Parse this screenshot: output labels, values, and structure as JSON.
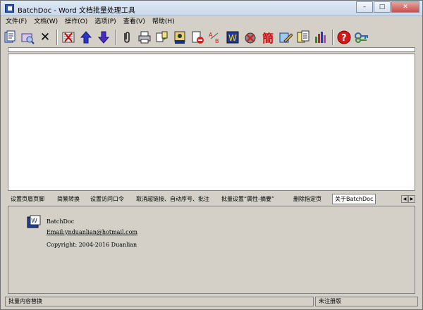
{
  "window": {
    "title": "BatchDoc - Word 文档批量处理工具",
    "buttons": {
      "minimize": "–",
      "maximize": "□",
      "close": "✕"
    }
  },
  "menu": [
    {
      "label": "文件(F)"
    },
    {
      "label": "文档(W)"
    },
    {
      "label": "操作(O)"
    },
    {
      "label": "选项(P)"
    },
    {
      "label": "查看(V)"
    },
    {
      "label": "帮助(H)"
    }
  ],
  "toolbar": {
    "jian_glyph": "簡",
    "help_glyph": "?",
    "delete_glyph": "✕",
    "ab_glyph": "AB"
  },
  "tabs": [
    {
      "label": "设置页眉页脚"
    },
    {
      "label": "简繁转换"
    },
    {
      "label": "设置访问口令"
    },
    {
      "label": "取消超链接、自动序号、批注"
    },
    {
      "label": "批量设置“属性-摘要”"
    },
    {
      "label": "删除指定页"
    },
    {
      "label": "关于BatchDoc"
    }
  ],
  "tab_scroll": {
    "left": "◀",
    "right": "▶"
  },
  "about": {
    "name": "BatchDoc",
    "email": "Email:ynduanlian@hotmail.com",
    "copyright": "Copyright: 2004-2016 Duanlian"
  },
  "status": {
    "left": "批量内容替换",
    "right": "未注册版"
  }
}
